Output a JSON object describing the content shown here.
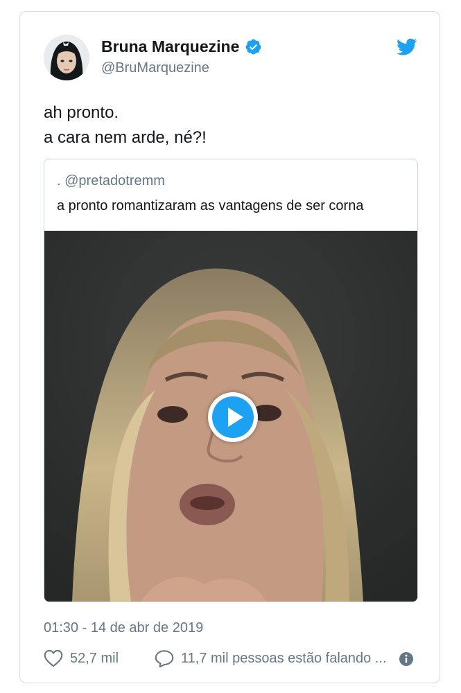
{
  "tweet": {
    "author_name": "Bruna Marquezine",
    "author_handle": "@BruMarquezine",
    "text_line1": "ah pronto.",
    "text_line2": "a cara nem arde, né?!",
    "timestamp": "01:30 - 14 de abr de 2019",
    "likes": "52,7 mil",
    "conversation": "11,7 mil pessoas estão falando ..."
  },
  "quote": {
    "prefix": ".",
    "handle": "@pretadotremm",
    "text": "a pronto romantizaram as vantagens de ser corna"
  },
  "icons": {
    "verified": "verified-badge-icon",
    "brand": "twitter-bird-icon",
    "play": "play-icon",
    "like": "heart-icon",
    "reply": "speech-bubble-icon",
    "info": "info-icon"
  },
  "colors": {
    "accent": "#1da1f2",
    "text": "#14171a",
    "secondary": "#657786",
    "border": "#ccd6dd",
    "media_bg": "#2e2f2f"
  }
}
